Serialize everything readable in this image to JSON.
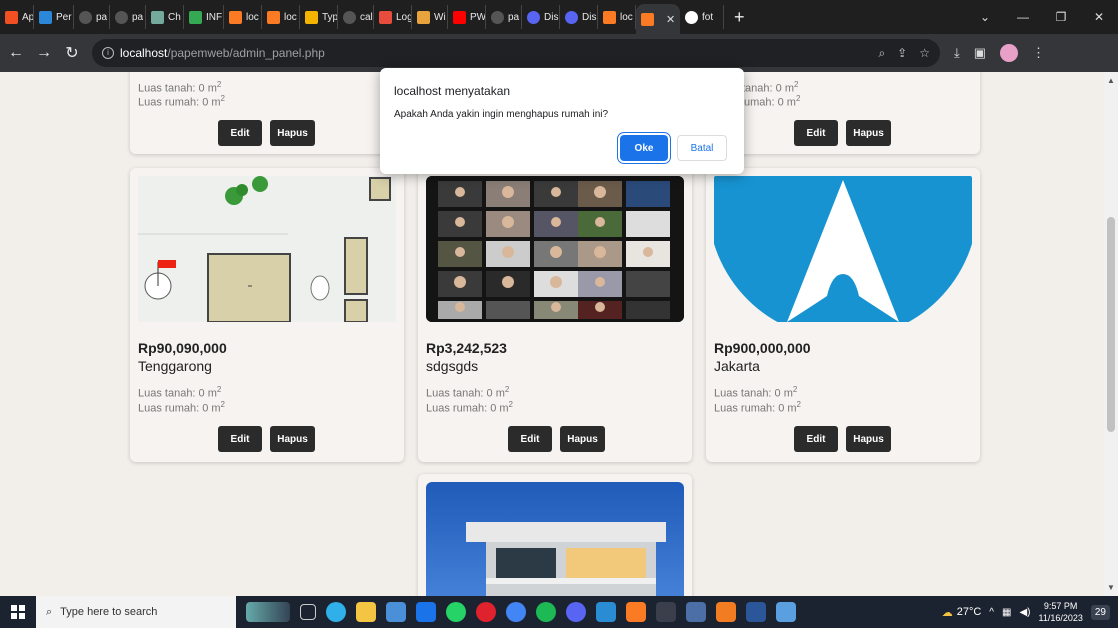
{
  "browser": {
    "tabs": [
      "Ap",
      "Per",
      "pa",
      "pa",
      "Ch",
      "INF",
      "loc",
      "loc",
      "Typ",
      "cal",
      "Log",
      "Wi",
      "PW",
      "pa",
      "Dis",
      "Dis",
      "loc",
      "",
      "fot"
    ],
    "active_tab_index": 17,
    "url_host": "localhost",
    "url_path": "/papemweb/admin_panel.php"
  },
  "dialog": {
    "title": "localhost menyatakan",
    "message": "Apakah Anda yakin ingin menghapus rumah ini?",
    "ok_label": "Oke",
    "cancel_label": "Batal"
  },
  "labels": {
    "edit": "Edit",
    "delete": "Hapus",
    "land_prefix": "Luas tanah: 0 m",
    "house_prefix": "Luas rumah: 0 m",
    "sq": "2",
    "land_prefix_partial": "tanah: 0 m",
    "house_prefix_partial": "umah: 0 m"
  },
  "listings": [
    {
      "price": "Rp90,090,000",
      "city": "Tenggarong"
    },
    {
      "price": "Rp3,242,523",
      "city": "sdgsgds"
    },
    {
      "price": "Rp900,000,000",
      "city": "Jakarta"
    }
  ],
  "taskbar": {
    "search_placeholder": "Type here to search",
    "temperature": "27°C",
    "time": "9:57 PM",
    "date": "11/16/2023",
    "notifications": "29"
  },
  "colors": {
    "accent": "#1a73e8",
    "button_dark": "#2b2b2b",
    "page_bg": "#f2efeb"
  }
}
